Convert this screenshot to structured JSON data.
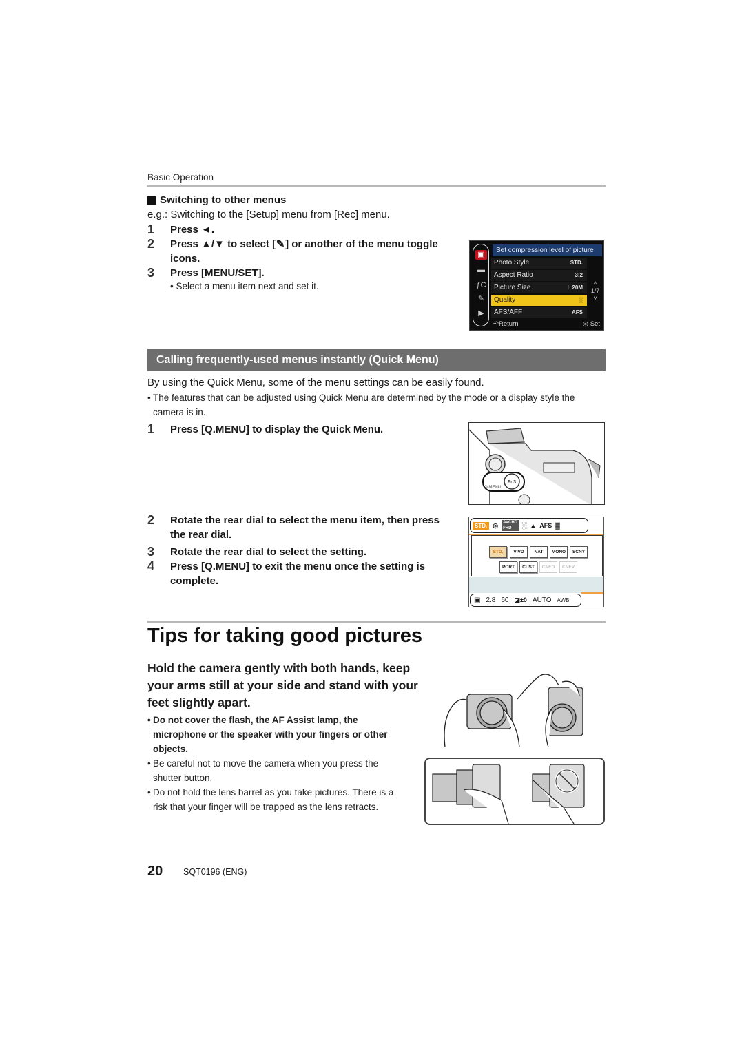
{
  "header": {
    "breadcrumb": "Basic Operation"
  },
  "switching": {
    "heading": "Switching to other menus",
    "example": "e.g.: Switching to the [Setup] menu from [Rec] menu.",
    "steps": [
      {
        "num": "1",
        "text": "Press ◄."
      },
      {
        "num": "2",
        "text_before": "Press ▲/▼ to select [",
        "icon": "✎",
        "text_after": "] or another of the menu toggle icons."
      },
      {
        "num": "3",
        "text": "Press [MENU/SET]."
      }
    ],
    "note": "• Select a menu item next and set it."
  },
  "menu_screen": {
    "title": "Set compression level of picture",
    "side_icons": [
      "▣",
      "▬",
      "ƒC",
      "✎",
      "▶"
    ],
    "rows": [
      {
        "label": "Photo Style",
        "value": "STD."
      },
      {
        "label": "Aspect Ratio",
        "value": "3:2"
      },
      {
        "label": "Picture Size",
        "value": "L 20M"
      },
      {
        "label": "Quality",
        "value": "░",
        "selected": true
      },
      {
        "label": "AFS/AFF",
        "value": "AFS"
      }
    ],
    "page": "1/7",
    "page_up": "˄",
    "page_down": "˅",
    "return_label": "↶Return",
    "set_label": "◎ Set"
  },
  "quick_menu_section": {
    "banner": "Calling frequently-used menus instantly (Quick Menu)",
    "intro": "By using the Quick Menu, some of the menu settings can be easily found.",
    "bullet": "The features that can be adjusted using Quick Menu are determined by the mode or a display style the camera is in.",
    "steps": [
      {
        "num": "1",
        "text": "Press [Q.MENU] to display the Quick Menu."
      },
      {
        "num": "2",
        "text": "Rotate the rear dial to select the menu item, then press the rear dial."
      },
      {
        "num": "3",
        "text": "Rotate the rear dial to select the setting."
      },
      {
        "num": "4",
        "text": "Press [Q.MENU] to exit the menu once the setting is complete."
      }
    ],
    "camera_labels": {
      "qmenu": "Q.MENU",
      "fn": "Fn3"
    }
  },
  "quick_menu_screen": {
    "top_items": [
      "STD.",
      "◎",
      "AVCHD",
      "FHD",
      "░",
      "AFS",
      "▓"
    ],
    "options_row1": [
      "STD.",
      "VIVD",
      "NAT",
      "MONO",
      "SCNY"
    ],
    "options_row2": [
      "PORT",
      "CUST",
      "CNED",
      "CNEV"
    ],
    "bottom_items": [
      "▣",
      "2.8",
      "60",
      "◪±0",
      "AUTO",
      "AWB"
    ]
  },
  "tips": {
    "title": "Tips for taking good pictures",
    "lead": "Hold the camera gently with both hands, keep your arms still at your side and stand with your feet slightly apart.",
    "bullets": [
      {
        "text": "Do not cover the flash, the AF Assist lamp, the microphone or the speaker with your fingers or other objects.",
        "bold": true
      },
      {
        "text": "Be careful not to move the camera when you press the shutter button.",
        "bold": false
      },
      {
        "text": "Do not hold the lens barrel as you take pictures. There is a risk that your finger will be trapped as the lens retracts.",
        "bold": false
      }
    ]
  },
  "footer": {
    "page_number": "20",
    "doc_code": "SQT0196 (ENG)"
  }
}
